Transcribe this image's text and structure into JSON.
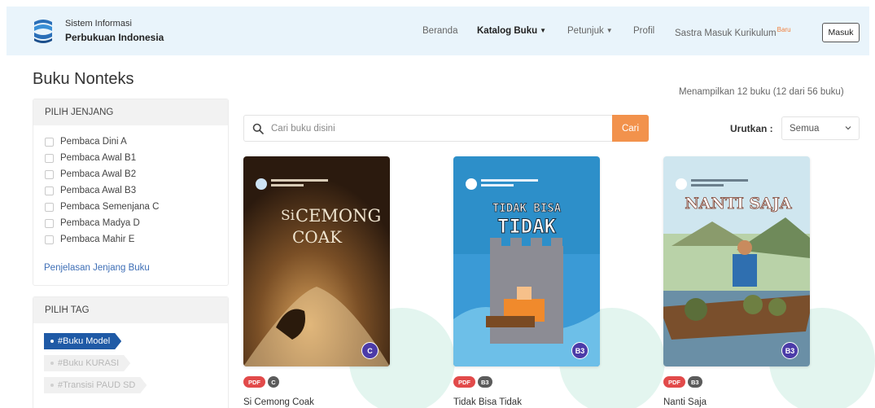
{
  "header": {
    "brand_line1": "Sistem Informasi",
    "brand_line2": "Perbukuan Indonesia",
    "nav": {
      "beranda": "Beranda",
      "katalog": "Katalog Buku",
      "petunjuk": "Petunjuk",
      "profil": "Profil",
      "sastra": "Sastra Masuk Kurikulum",
      "sastra_badge": "Baru"
    },
    "login_label": "Masuk"
  },
  "page": {
    "title": "Buku Nonteks",
    "result_count": "Menampilkan 12 buku (12 dari 56 buku)"
  },
  "sidebar": {
    "jenjang_title": "PILIH JENJANG",
    "jenjang_items": [
      "Pembaca Dini A",
      "Pembaca Awal B1",
      "Pembaca Awal B2",
      "Pembaca Awal B3",
      "Pembaca Semenjana C",
      "Pembaca Madya D",
      "Pembaca Mahir E"
    ],
    "jenjang_link": "Penjelasan Jenjang Buku",
    "tag_title": "PILIH TAG",
    "tags": [
      "#Buku Model",
      "#Buku KURASI",
      "#Transisi PAUD SD"
    ]
  },
  "search": {
    "placeholder": "Cari buku disini",
    "value": "",
    "button_label": "Cari"
  },
  "sort": {
    "label": "Urutkan :",
    "selected": "Semua"
  },
  "books": [
    {
      "title": "Si Cemong Coak",
      "format": "PDF",
      "level": "C",
      "cover_text_1": "Si",
      "cover_text_2": "CEMONG",
      "cover_text_3": "COAK"
    },
    {
      "title": "Tidak Bisa Tidak",
      "format": "PDF",
      "level": "B3",
      "cover_text_1": "TIDAK BISA",
      "cover_text_2": "TIDAK"
    },
    {
      "title": "Nanti Saja",
      "format": "PDF",
      "level": "B3",
      "cover_text_1": "NANTI SAJA"
    }
  ],
  "colors": {
    "header_bg": "#e9f4fb",
    "accent_orange": "#f2924c",
    "tag_active": "#1f5aa6",
    "link_blue": "#3f6fb6",
    "pdf_red": "#e24a4a",
    "level_purple": "#4b3ba8"
  },
  "icons": {
    "logo": "sipi-logo-icon",
    "search": "search-icon",
    "dropdown": "chevron-down-icon"
  }
}
